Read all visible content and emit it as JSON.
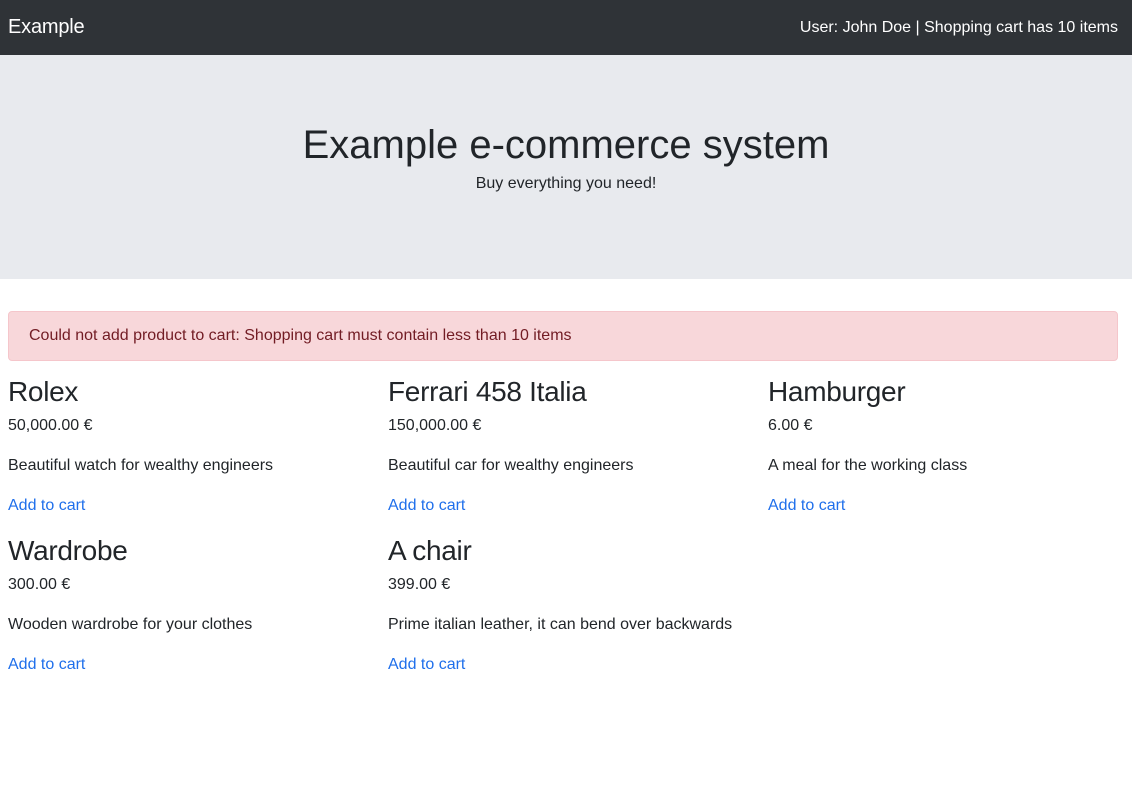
{
  "navbar": {
    "brand": "Example",
    "status": "User: John Doe | Shopping cart has 10 items"
  },
  "hero": {
    "title": "Example e-commerce system",
    "subtitle": "Buy everything you need!"
  },
  "alert": {
    "message": "Could not add product to cart: Shopping cart must contain less than 10 items"
  },
  "products": [
    {
      "name": "Rolex",
      "price": "50,000.00 €",
      "description": "Beautiful watch for wealthy engineers",
      "action_label": "Add to cart"
    },
    {
      "name": "Ferrari 458 Italia",
      "price": "150,000.00 €",
      "description": "Beautiful car for wealthy engineers",
      "action_label": "Add to cart"
    },
    {
      "name": "Hamburger",
      "price": "6.00 €",
      "description": "A meal for the working class",
      "action_label": "Add to cart"
    },
    {
      "name": "Wardrobe",
      "price": "300.00 €",
      "description": "Wooden wardrobe for your clothes",
      "action_label": "Add to cart"
    },
    {
      "name": "A chair",
      "price": "399.00 €",
      "description": "Prime italian leather, it can bend over backwards",
      "action_label": "Add to cart"
    }
  ]
}
